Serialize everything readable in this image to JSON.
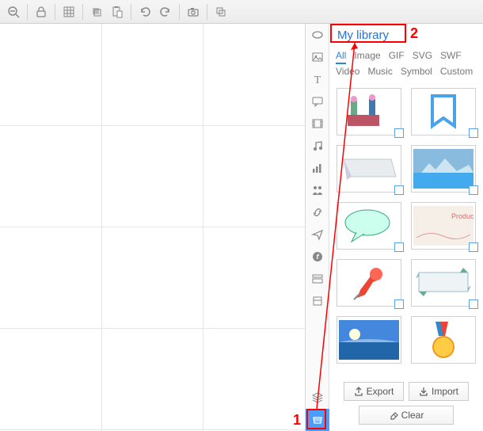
{
  "toolbar": {
    "zoom_out": "zoom-out",
    "lock": "lock",
    "grid": "grid",
    "copy": "copy",
    "paste": "paste",
    "undo": "undo",
    "redo": "redo",
    "camera": "camera",
    "crop": "crop"
  },
  "side": {
    "shape": "shape",
    "image": "image",
    "text": "text",
    "callout": "callout",
    "video": "video",
    "music": "music",
    "chart": "chart",
    "people": "people",
    "link": "link",
    "plane": "plane",
    "flash": "flash",
    "form": "form",
    "misc1": "misc",
    "layers": "layers",
    "library": "library"
  },
  "panel": {
    "title": "My library",
    "tabs": [
      "All",
      "Image",
      "GIF",
      "SVG",
      "SWF",
      "Video",
      "Music",
      "Symbol",
      "Custom"
    ],
    "activeTab": "All",
    "export": "Export",
    "import": "Import",
    "clear": "Clear"
  },
  "thumbs": [
    {
      "name": "office-scene"
    },
    {
      "name": "bookmark"
    },
    {
      "name": "speech-banner-grey"
    },
    {
      "name": "landscape-blue"
    },
    {
      "name": "speech-bubble-green"
    },
    {
      "name": "product-card"
    },
    {
      "name": "pushpin-red"
    },
    {
      "name": "ribbon-frame"
    },
    {
      "name": "sunset-landscape"
    },
    {
      "name": "medal"
    }
  ],
  "annotations": {
    "num1": "1",
    "num2": "2"
  }
}
